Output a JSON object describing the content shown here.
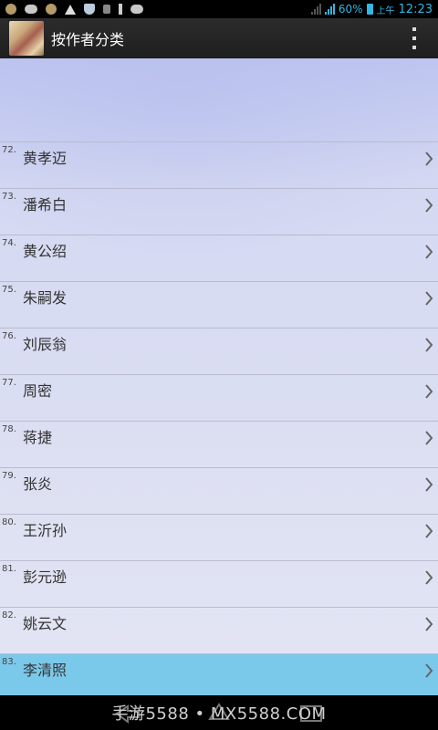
{
  "status_bar": {
    "battery": "60%",
    "period": "上午",
    "time": "12:23"
  },
  "action_bar": {
    "title": "按作者分类"
  },
  "authors": [
    {
      "num": "72.",
      "name": "黄孝迈"
    },
    {
      "num": "73.",
      "name": "潘希白"
    },
    {
      "num": "74.",
      "name": "黄公绍"
    },
    {
      "num": "75.",
      "name": "朱嗣发"
    },
    {
      "num": "76.",
      "name": "刘辰翁"
    },
    {
      "num": "77.",
      "name": "周密"
    },
    {
      "num": "78.",
      "name": "蒋捷"
    },
    {
      "num": "79.",
      "name": "张炎"
    },
    {
      "num": "80.",
      "name": "王沂孙"
    },
    {
      "num": "81.",
      "name": "彭元逊"
    },
    {
      "num": "82.",
      "name": "姚云文"
    },
    {
      "num": "83.",
      "name": "李清照"
    }
  ],
  "selected_index": 11,
  "watermark": "手游5588 • MX5588.COM",
  "colors": {
    "accent": "#33b5e5",
    "selected_row": "#7bc9ea",
    "divider": "#b9bccd"
  }
}
